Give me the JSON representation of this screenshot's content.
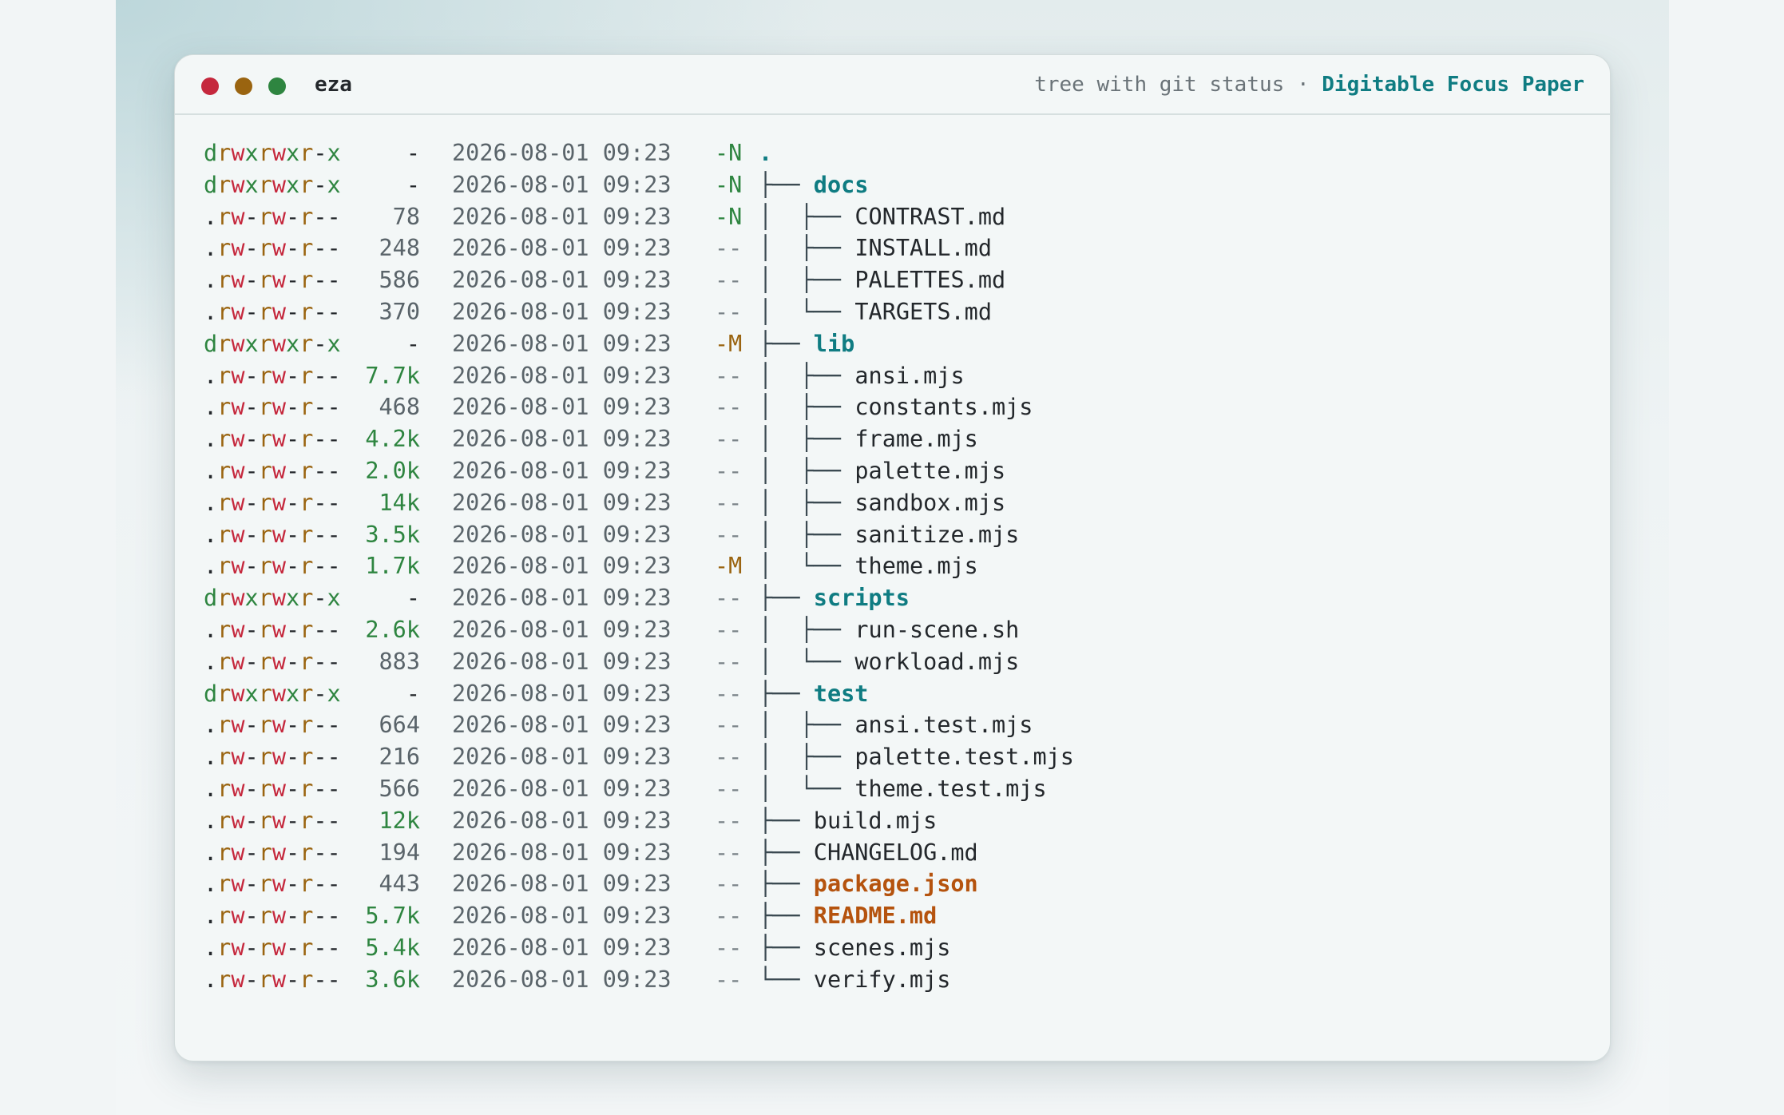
{
  "window": {
    "app_name": "eza",
    "subtitle": "tree with git status",
    "separator": "·",
    "theme_name": "Digitable Focus Paper",
    "traffic_lights": {
      "close": "#c5283d",
      "minimize": "#9a6410",
      "zoom": "#2e8540"
    }
  },
  "colors": {
    "dir": "#0f7c82",
    "special_file": "#b5530e",
    "git_new": "#2e8540",
    "git_modified": "#9a6410",
    "perm_read": "#9a6410",
    "perm_write": "#c5283d",
    "perm_exec": "#2e8540"
  },
  "rows": [
    {
      "perm": "drwxrwxr-x",
      "size": "-",
      "date": "2026-08-01 09:23",
      "git": "-N",
      "tree": "",
      "name": ".",
      "kind": "root"
    },
    {
      "perm": "drwxrwxr-x",
      "size": "-",
      "date": "2026-08-01 09:23",
      "git": "-N",
      "tree": "├── ",
      "name": "docs",
      "kind": "dir"
    },
    {
      "perm": ".rw-rw-r--",
      "size": "78",
      "date": "2026-08-01 09:23",
      "git": "-N",
      "tree": "│  ├── ",
      "name": "CONTRAST.md",
      "kind": "file"
    },
    {
      "perm": ".rw-rw-r--",
      "size": "248",
      "date": "2026-08-01 09:23",
      "git": "--",
      "tree": "│  ├── ",
      "name": "INSTALL.md",
      "kind": "file"
    },
    {
      "perm": ".rw-rw-r--",
      "size": "586",
      "date": "2026-08-01 09:23",
      "git": "--",
      "tree": "│  ├── ",
      "name": "PALETTES.md",
      "kind": "file"
    },
    {
      "perm": ".rw-rw-r--",
      "size": "370",
      "date": "2026-08-01 09:23",
      "git": "--",
      "tree": "│  └── ",
      "name": "TARGETS.md",
      "kind": "file"
    },
    {
      "perm": "drwxrwxr-x",
      "size": "-",
      "date": "2026-08-01 09:23",
      "git": "-M",
      "tree": "├── ",
      "name": "lib",
      "kind": "dir"
    },
    {
      "perm": ".rw-rw-r--",
      "size": "7.7k",
      "date": "2026-08-01 09:23",
      "git": "--",
      "tree": "│  ├── ",
      "name": "ansi.mjs",
      "kind": "file"
    },
    {
      "perm": ".rw-rw-r--",
      "size": "468",
      "date": "2026-08-01 09:23",
      "git": "--",
      "tree": "│  ├── ",
      "name": "constants.mjs",
      "kind": "file"
    },
    {
      "perm": ".rw-rw-r--",
      "size": "4.2k",
      "date": "2026-08-01 09:23",
      "git": "--",
      "tree": "│  ├── ",
      "name": "frame.mjs",
      "kind": "file"
    },
    {
      "perm": ".rw-rw-r--",
      "size": "2.0k",
      "date": "2026-08-01 09:23",
      "git": "--",
      "tree": "│  ├── ",
      "name": "palette.mjs",
      "kind": "file"
    },
    {
      "perm": ".rw-rw-r--",
      "size": "14k",
      "date": "2026-08-01 09:23",
      "git": "--",
      "tree": "│  ├── ",
      "name": "sandbox.mjs",
      "kind": "file"
    },
    {
      "perm": ".rw-rw-r--",
      "size": "3.5k",
      "date": "2026-08-01 09:23",
      "git": "--",
      "tree": "│  ├── ",
      "name": "sanitize.mjs",
      "kind": "file"
    },
    {
      "perm": ".rw-rw-r--",
      "size": "1.7k",
      "date": "2026-08-01 09:23",
      "git": "-M",
      "tree": "│  └── ",
      "name": "theme.mjs",
      "kind": "file"
    },
    {
      "perm": "drwxrwxr-x",
      "size": "-",
      "date": "2026-08-01 09:23",
      "git": "--",
      "tree": "├── ",
      "name": "scripts",
      "kind": "dir"
    },
    {
      "perm": ".rw-rw-r--",
      "size": "2.6k",
      "date": "2026-08-01 09:23",
      "git": "--",
      "tree": "│  ├── ",
      "name": "run-scene.sh",
      "kind": "file"
    },
    {
      "perm": ".rw-rw-r--",
      "size": "883",
      "date": "2026-08-01 09:23",
      "git": "--",
      "tree": "│  └── ",
      "name": "workload.mjs",
      "kind": "file"
    },
    {
      "perm": "drwxrwxr-x",
      "size": "-",
      "date": "2026-08-01 09:23",
      "git": "--",
      "tree": "├── ",
      "name": "test",
      "kind": "dir"
    },
    {
      "perm": ".rw-rw-r--",
      "size": "664",
      "date": "2026-08-01 09:23",
      "git": "--",
      "tree": "│  ├── ",
      "name": "ansi.test.mjs",
      "kind": "file"
    },
    {
      "perm": ".rw-rw-r--",
      "size": "216",
      "date": "2026-08-01 09:23",
      "git": "--",
      "tree": "│  ├── ",
      "name": "palette.test.mjs",
      "kind": "file"
    },
    {
      "perm": ".rw-rw-r--",
      "size": "566",
      "date": "2026-08-01 09:23",
      "git": "--",
      "tree": "│  └── ",
      "name": "theme.test.mjs",
      "kind": "file"
    },
    {
      "perm": ".rw-rw-r--",
      "size": "12k",
      "date": "2026-08-01 09:23",
      "git": "--",
      "tree": "├── ",
      "name": "build.mjs",
      "kind": "file"
    },
    {
      "perm": ".rw-rw-r--",
      "size": "194",
      "date": "2026-08-01 09:23",
      "git": "--",
      "tree": "├── ",
      "name": "CHANGELOG.md",
      "kind": "file"
    },
    {
      "perm": ".rw-rw-r--",
      "size": "443",
      "date": "2026-08-01 09:23",
      "git": "--",
      "tree": "├── ",
      "name": "package.json",
      "kind": "special"
    },
    {
      "perm": ".rw-rw-r--",
      "size": "5.7k",
      "date": "2026-08-01 09:23",
      "git": "--",
      "tree": "├── ",
      "name": "README.md",
      "kind": "special"
    },
    {
      "perm": ".rw-rw-r--",
      "size": "5.4k",
      "date": "2026-08-01 09:23",
      "git": "--",
      "tree": "├── ",
      "name": "scenes.mjs",
      "kind": "file"
    },
    {
      "perm": ".rw-rw-r--",
      "size": "3.6k",
      "date": "2026-08-01 09:23",
      "git": "--",
      "tree": "└── ",
      "name": "verify.mjs",
      "kind": "file"
    }
  ]
}
